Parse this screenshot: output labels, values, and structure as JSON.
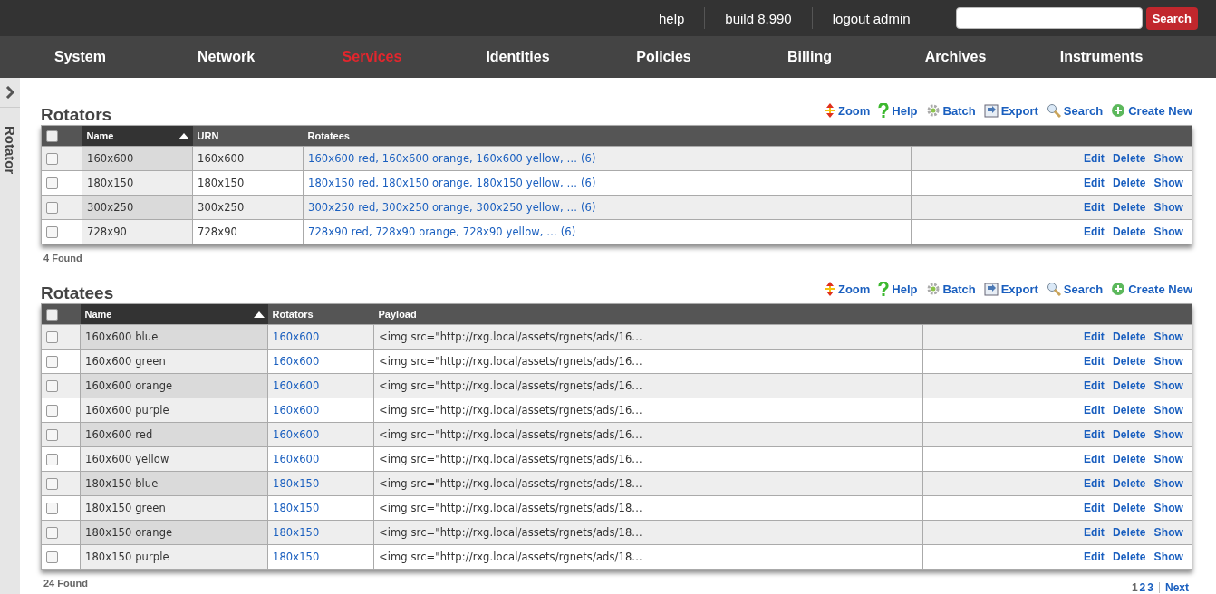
{
  "top_links": [
    "help",
    "build 8.990",
    "logout admin"
  ],
  "search": {
    "button": "Search"
  },
  "nav": [
    {
      "label": "System",
      "selected": false
    },
    {
      "label": "Network",
      "selected": false
    },
    {
      "label": "Services",
      "selected": true
    },
    {
      "label": "Identities",
      "selected": false
    },
    {
      "label": "Policies",
      "selected": false
    },
    {
      "label": "Billing",
      "selected": false
    },
    {
      "label": "Archives",
      "selected": false
    },
    {
      "label": "Instruments",
      "selected": false
    }
  ],
  "sidebar": {
    "label": "Rotator"
  },
  "sections": [
    {
      "title": "Rotators",
      "select_all_checked": false,
      "toolbar": [
        {
          "kind": "zoom",
          "label": "Zoom"
        },
        {
          "kind": "help",
          "label": "Help"
        },
        {
          "kind": "batch",
          "label": "Batch"
        },
        {
          "kind": "export",
          "label": "Export"
        },
        {
          "kind": "search",
          "label": "Search"
        },
        {
          "kind": "create",
          "label": "Create New"
        }
      ],
      "columns": [
        {
          "label": "Name",
          "kind": "text",
          "sorted": true
        },
        {
          "label": "URN",
          "kind": "text",
          "sorted": false
        },
        {
          "label": "Rotatees",
          "kind": "link",
          "sorted": false
        }
      ],
      "rows": [
        {
          "checked": false,
          "cells": [
            "160x600",
            "160x600",
            "160x600 red, 160x600 orange, 160x600 yellow, … (6)"
          ],
          "actions": [
            "Edit",
            "Delete",
            "Show"
          ]
        },
        {
          "checked": false,
          "cells": [
            "180x150",
            "180x150",
            "180x150 red, 180x150 orange, 180x150 yellow, … (6)"
          ],
          "actions": [
            "Edit",
            "Delete",
            "Show"
          ]
        },
        {
          "checked": false,
          "cells": [
            "300x250",
            "300x250",
            "300x250 red, 300x250 orange, 300x250 yellow, … (6)"
          ],
          "actions": [
            "Edit",
            "Delete",
            "Show"
          ]
        },
        {
          "checked": false,
          "cells": [
            "728x90",
            "728x90",
            "728x90 red, 728x90 orange, 728x90 yellow, … (6)"
          ],
          "actions": [
            "Edit",
            "Delete",
            "Show"
          ]
        }
      ],
      "found": "4 Found"
    },
    {
      "title": "Rotatees",
      "select_all_checked": false,
      "toolbar": [
        {
          "kind": "zoom",
          "label": "Zoom"
        },
        {
          "kind": "help",
          "label": "Help"
        },
        {
          "kind": "batch",
          "label": "Batch"
        },
        {
          "kind": "export",
          "label": "Export"
        },
        {
          "kind": "search",
          "label": "Search"
        },
        {
          "kind": "create",
          "label": "Create New"
        }
      ],
      "columns": [
        {
          "label": "Name",
          "kind": "text",
          "sorted": true
        },
        {
          "label": "Rotators",
          "kind": "link",
          "sorted": false
        },
        {
          "label": "Payload",
          "kind": "text",
          "sorted": false
        }
      ],
      "rows": [
        {
          "checked": false,
          "cells": [
            "160x600 blue",
            "160x600",
            "<img src=\"http://rxg.local/assets/rgnets/ads/16..."
          ],
          "actions": [
            "Edit",
            "Delete",
            "Show"
          ]
        },
        {
          "checked": false,
          "cells": [
            "160x600 green",
            "160x600",
            "<img src=\"http://rxg.local/assets/rgnets/ads/16..."
          ],
          "actions": [
            "Edit",
            "Delete",
            "Show"
          ]
        },
        {
          "checked": false,
          "cells": [
            "160x600 orange",
            "160x600",
            "<img src=\"http://rxg.local/assets/rgnets/ads/16..."
          ],
          "actions": [
            "Edit",
            "Delete",
            "Show"
          ]
        },
        {
          "checked": false,
          "cells": [
            "160x600 purple",
            "160x600",
            "<img src=\"http://rxg.local/assets/rgnets/ads/16..."
          ],
          "actions": [
            "Edit",
            "Delete",
            "Show"
          ]
        },
        {
          "checked": false,
          "cells": [
            "160x600 red",
            "160x600",
            "<img src=\"http://rxg.local/assets/rgnets/ads/16..."
          ],
          "actions": [
            "Edit",
            "Delete",
            "Show"
          ]
        },
        {
          "checked": false,
          "cells": [
            "160x600 yellow",
            "160x600",
            "<img src=\"http://rxg.local/assets/rgnets/ads/16..."
          ],
          "actions": [
            "Edit",
            "Delete",
            "Show"
          ]
        },
        {
          "checked": false,
          "cells": [
            "180x150 blue",
            "180x150",
            "<img src=\"http://rxg.local/assets/rgnets/ads/18..."
          ],
          "actions": [
            "Edit",
            "Delete",
            "Show"
          ]
        },
        {
          "checked": false,
          "cells": [
            "180x150 green",
            "180x150",
            "<img src=\"http://rxg.local/assets/rgnets/ads/18..."
          ],
          "actions": [
            "Edit",
            "Delete",
            "Show"
          ]
        },
        {
          "checked": false,
          "cells": [
            "180x150 orange",
            "180x150",
            "<img src=\"http://rxg.local/assets/rgnets/ads/18..."
          ],
          "actions": [
            "Edit",
            "Delete",
            "Show"
          ]
        },
        {
          "checked": false,
          "cells": [
            "180x150 purple",
            "180x150",
            "<img src=\"http://rxg.local/assets/rgnets/ads/18..."
          ],
          "actions": [
            "Edit",
            "Delete",
            "Show"
          ]
        }
      ],
      "found": "24 Found",
      "pagination": {
        "pages": [
          {
            "label": "1",
            "selected": true
          },
          {
            "label": "2",
            "selected": false
          },
          {
            "label": "3",
            "selected": false
          }
        ],
        "next": "Next"
      }
    }
  ]
}
